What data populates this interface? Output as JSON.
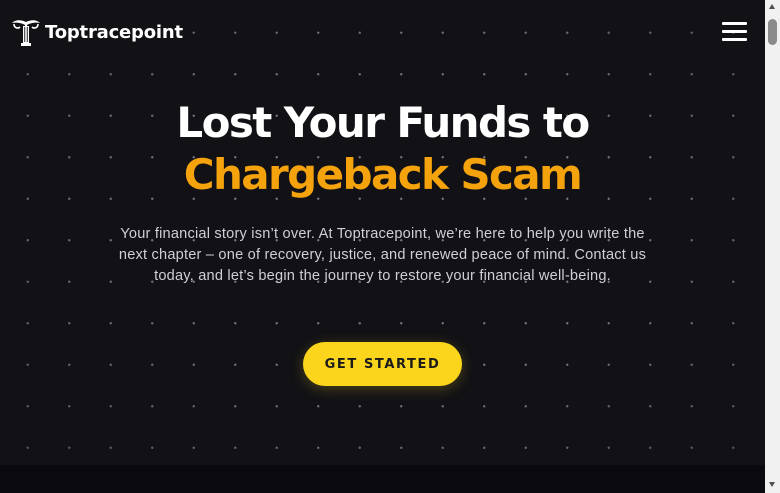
{
  "brand": {
    "name": "Toptracepoint",
    "logo_icon": "pillar-logo-icon"
  },
  "header": {
    "menu_icon": "hamburger-menu-icon"
  },
  "hero": {
    "title_line1": "Lost Your Funds to",
    "title_line2": "Chargeback Scam",
    "description": "Your financial story isn’t over. At Toptracepoint, we’re here to help you write the next chapter – one of recovery, justice, and renewed peace of mind. Contact us today, and let’s begin the journey to restore your financial well-being.",
    "cta_label": "GET STARTED"
  },
  "colors": {
    "background": "#111116",
    "accent_orange": "#f5a30c",
    "button_yellow": "#fbd51b",
    "text_white": "#ffffff"
  }
}
